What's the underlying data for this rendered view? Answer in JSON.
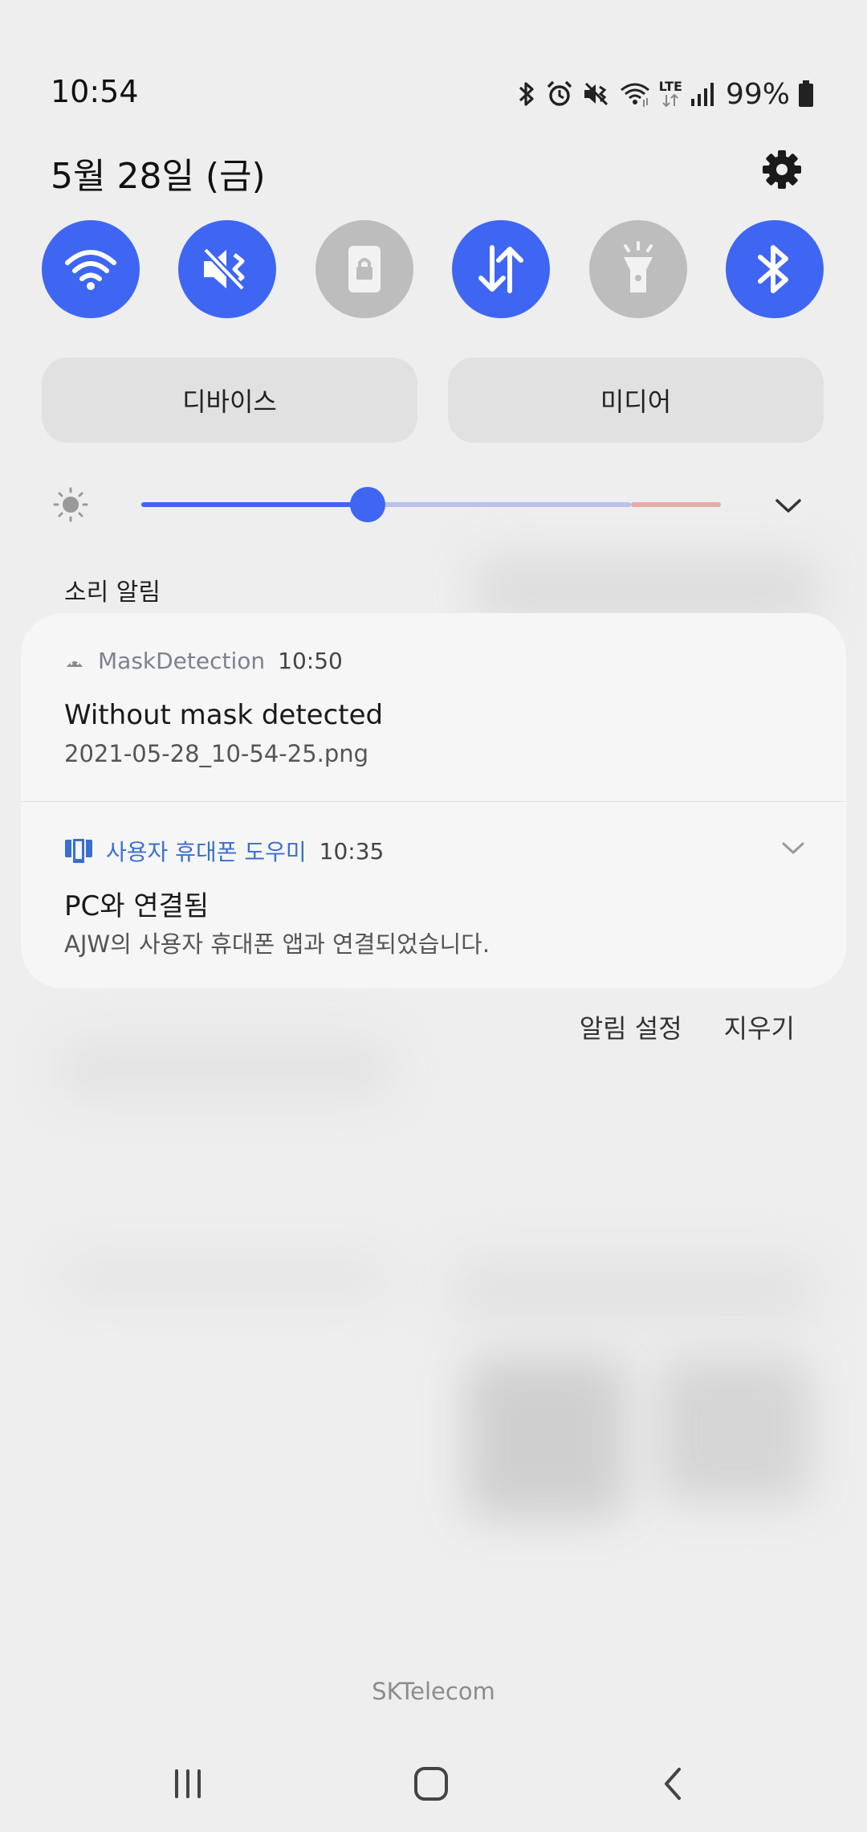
{
  "status": {
    "time": "10:54",
    "battery": "99%",
    "icons": [
      "bluetooth-icon",
      "alarm-icon",
      "mute-icon",
      "wifi-icon",
      "lte-icon",
      "signal-icon",
      "battery-icon"
    ],
    "lte": "LTE"
  },
  "header": {
    "date": "5월 28일 (금)"
  },
  "quick_settings": [
    {
      "name": "wifi",
      "state": "on"
    },
    {
      "name": "sound-mute",
      "state": "on"
    },
    {
      "name": "rotation-lock",
      "state": "off"
    },
    {
      "name": "mobile-data",
      "state": "on"
    },
    {
      "name": "flashlight",
      "state": "off"
    },
    {
      "name": "bluetooth",
      "state": "on"
    }
  ],
  "pills": {
    "devices": "디바이스",
    "media": "미디어"
  },
  "brightness": {
    "level": 0.39
  },
  "section": {
    "label": "소리 알림"
  },
  "notifications": [
    {
      "app": "MaskDetection",
      "time": "10:50",
      "title": "Without mask detected",
      "body": "2021-05-28_10-54-25.png"
    },
    {
      "app": "사용자 휴대폰 도우미",
      "time": "10:35",
      "title": "PC와 연결됨",
      "body": "AJW의 사용자 휴대폰 앱과 연결되었습니다."
    }
  ],
  "actions": {
    "settings": "알림 설정",
    "clear": "지우기"
  },
  "carrier": "SKTelecom",
  "colors": {
    "accent": "#3e66f2",
    "off": "#bdbdbe",
    "background": "#eeeeef"
  }
}
